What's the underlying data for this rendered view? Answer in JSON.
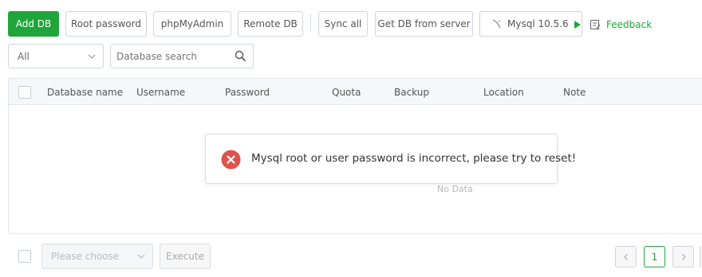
{
  "toolbar": {
    "add_db": "Add DB",
    "root_password": "Root password",
    "phpmyadmin": "phpMyAdmin",
    "remote_db": "Remote DB",
    "sync_all": "Sync all",
    "get_db_from_server": "Get DB from server",
    "mysql_version": "Mysql 10.5.6",
    "feedback": "Feedback"
  },
  "filter": {
    "category_selected": "All",
    "search_placeholder": "Database search"
  },
  "table": {
    "columns": [
      "Database name",
      "Username",
      "Password",
      "Quota",
      "Backup",
      "Location",
      "Note"
    ],
    "empty_text": "No Data"
  },
  "toast": {
    "message": "Mysql root or user password is incorrect, please try to reset!"
  },
  "footer": {
    "batch_placeholder": "Please choose",
    "execute_label": "Execute",
    "current_page": "1"
  },
  "colors": {
    "primary": "#20a53a",
    "error": "#e0534a"
  }
}
